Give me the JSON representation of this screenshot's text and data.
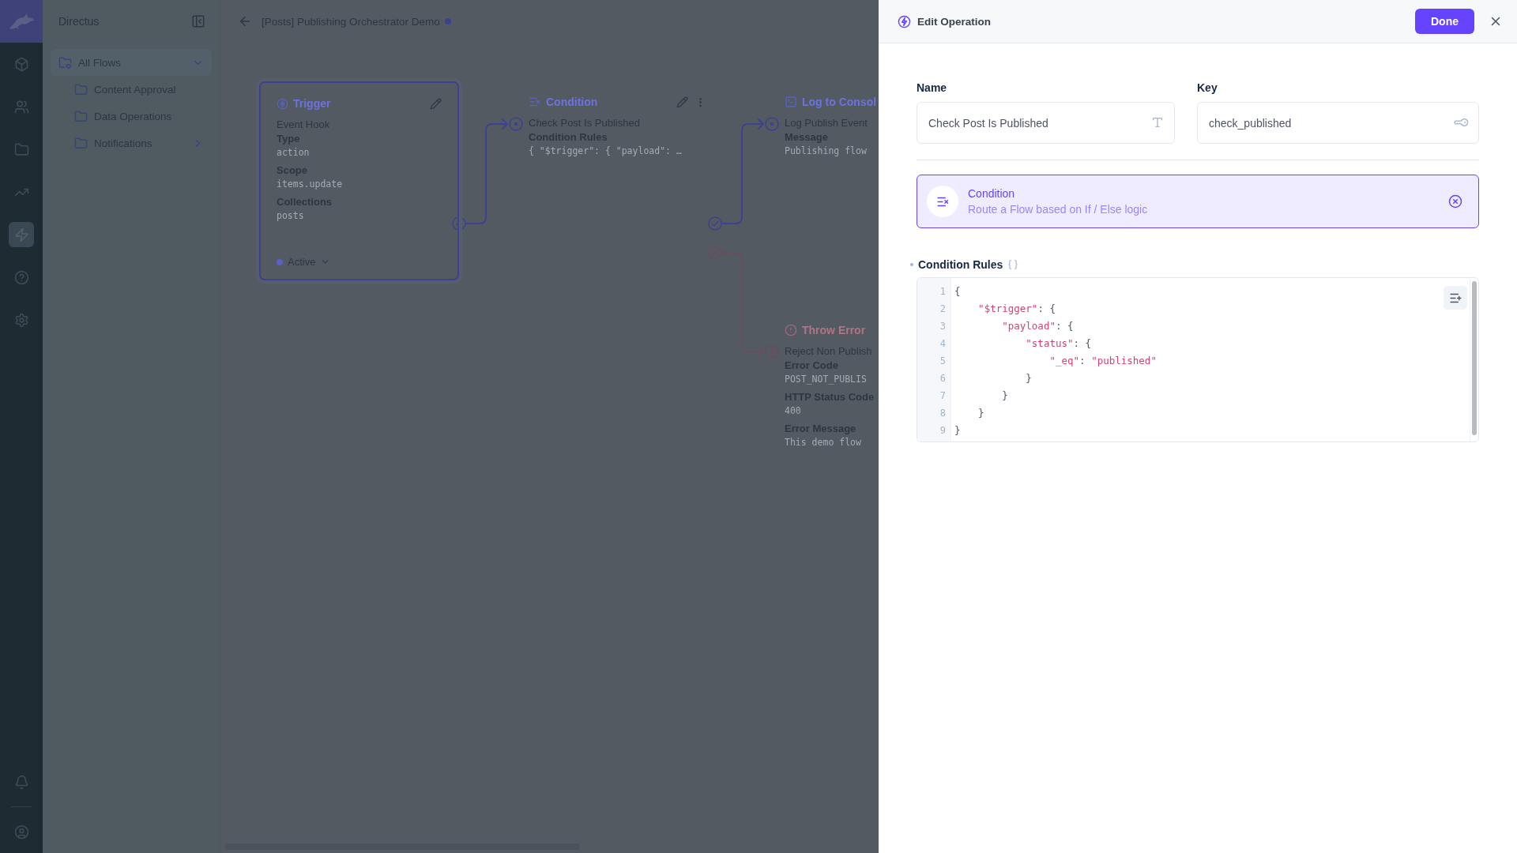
{
  "rail": {
    "items": [
      {
        "kind": "box",
        "selected": false
      },
      {
        "kind": "users",
        "selected": false
      },
      {
        "kind": "folder",
        "selected": false
      },
      {
        "kind": "chart",
        "selected": false
      },
      {
        "kind": "flows",
        "selected": true
      },
      {
        "kind": "help",
        "selected": false
      },
      {
        "kind": "settings",
        "selected": false
      }
    ],
    "bottom": [
      {
        "kind": "bell"
      },
      {
        "kind": "user"
      }
    ]
  },
  "nav": {
    "title": "Directus",
    "folders": [
      {
        "label": "All Flows",
        "expanded": true,
        "children": [
          {
            "label": "Content Approval",
            "expandable": false
          },
          {
            "label": "Data Operations",
            "expandable": false
          },
          {
            "label": "Notifications",
            "expandable": true
          }
        ]
      }
    ]
  },
  "header": {
    "title": "[Posts] Publishing Orchestrator Demo",
    "unsaved": true
  },
  "nodes": [
    {
      "kind": "trigger",
      "title": "Trigger",
      "name": "Event Hook",
      "fields": [
        {
          "label": "Type",
          "value": "action"
        },
        {
          "label": "Scope",
          "value": "items.update"
        },
        {
          "label": "Collections",
          "value": "posts"
        }
      ],
      "status": "Active"
    },
    {
      "kind": "condition",
      "title": "Condition",
      "name": "Check Post Is Published",
      "fields": [
        {
          "label": "Condition Rules",
          "value": "{ \"$trigger\": { \"payload\": …"
        }
      ]
    },
    {
      "kind": "log",
      "title": "Log to Consol",
      "name": "Log Publish Event",
      "fields": [
        {
          "label": "Message",
          "value": "Publishing flow"
        }
      ]
    },
    {
      "kind": "error",
      "title": "Throw Error",
      "name": "Reject Non Publish",
      "fields": [
        {
          "label": "Error Code",
          "value": "POST_NOT_PUBLIS"
        },
        {
          "label": "HTTP Status Code",
          "value": "400"
        },
        {
          "label": "Error Message",
          "value": "This demo flow"
        }
      ]
    }
  ],
  "drawer": {
    "title": "Edit Operation",
    "done": "Done",
    "name_field": {
      "label": "Name",
      "value": "Check Post Is Published"
    },
    "key_field": {
      "label": "Key",
      "value": "check_published"
    },
    "operation": {
      "title": "Condition",
      "description": "Route a Flow based on If / Else logic"
    },
    "rules": {
      "label": "Condition Rules",
      "required": true,
      "lines": [
        {
          "number": "1",
          "text": "{"
        },
        {
          "number": "2",
          "text": "    \"$trigger\": {"
        },
        {
          "number": "3",
          "text": "        \"payload\": {"
        },
        {
          "number": "4",
          "text": "            \"status\": {"
        },
        {
          "number": "5",
          "text": "                \"_eq\": \"published\""
        },
        {
          "number": "6",
          "text": "            }"
        },
        {
          "number": "7",
          "text": "        }"
        },
        {
          "number": "8",
          "text": "    }"
        },
        {
          "number": "9",
          "text": "}"
        }
      ]
    }
  }
}
